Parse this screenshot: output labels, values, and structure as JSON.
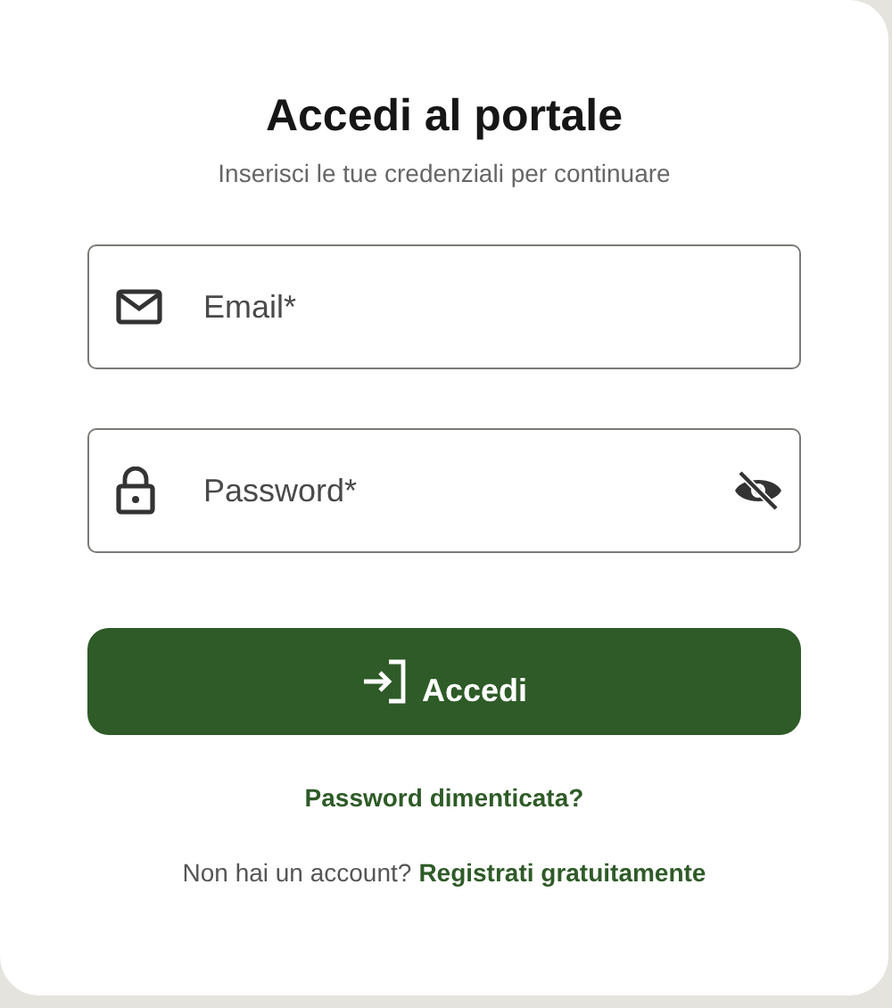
{
  "title": "Accedi al portale",
  "subtitle": "Inserisci le tue credenziali per continuare",
  "fields": [
    {
      "kind": "email",
      "placeholder": "Email*"
    },
    {
      "kind": "password",
      "placeholder": "Password*",
      "password_visible": false
    }
  ],
  "submit": {
    "label": "Accedi"
  },
  "forgot_link": "Password dimenticata?",
  "signup": {
    "prompt": "Non hai un account?",
    "link": "Registrati gratuitamente"
  }
}
